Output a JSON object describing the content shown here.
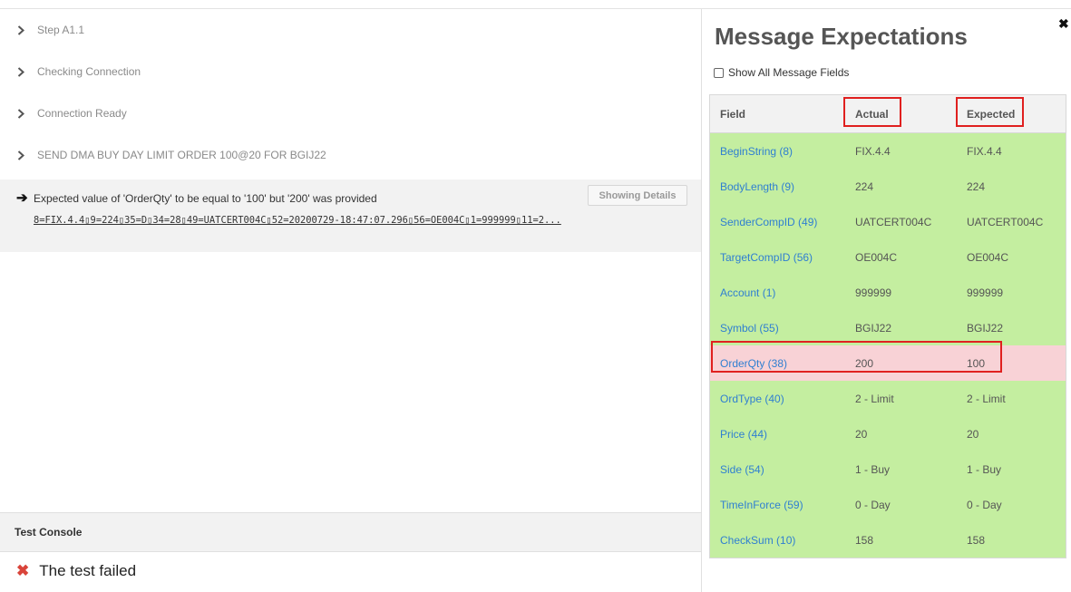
{
  "steps": [
    {
      "label": "Step A1.1"
    },
    {
      "label": "Checking Connection"
    },
    {
      "label": "Connection Ready"
    },
    {
      "label": "SEND DMA BUY DAY LIMIT ORDER 100@20 FOR BGIJ22"
    }
  ],
  "detail": {
    "message": "Expected value of 'OrderQty' to be equal to '100' but '200' was provided",
    "button_label": "Showing Details",
    "raw_message": "8=FIX.4.4▯9=224▯35=D▯34=28▯49=UATCERT004C▯52=20200729-18:47:07.296▯56=OE004C▯1=999999▯11=2..."
  },
  "console": {
    "header": "Test Console",
    "result": "The test failed",
    "status_color": "#d9443a"
  },
  "expectations": {
    "title": "Message Expectations",
    "show_all_label": "Show All Message Fields",
    "show_all_checked": false,
    "columns": {
      "field": "Field",
      "actual": "Actual",
      "expected": "Expected"
    },
    "rows": [
      {
        "field": "BeginString (8)",
        "actual": "FIX.4.4",
        "expected": "FIX.4.4",
        "match": true
      },
      {
        "field": "BodyLength (9)",
        "actual": "224",
        "expected": "224",
        "match": true
      },
      {
        "field": "SenderCompID (49)",
        "actual": "UATCERT004C",
        "expected": "UATCERT004C",
        "match": true
      },
      {
        "field": "TargetCompID (56)",
        "actual": "OE004C",
        "expected": "OE004C",
        "match": true
      },
      {
        "field": "Account (1)",
        "actual": "999999",
        "expected": "999999",
        "match": true
      },
      {
        "field": "Symbol (55)",
        "actual": "BGIJ22",
        "expected": "BGIJ22",
        "match": true
      },
      {
        "field": "OrderQty (38)",
        "actual": "200",
        "expected": "100",
        "match": false
      },
      {
        "field": "OrdType (40)",
        "actual": "2 - Limit",
        "expected": "2 - Limit",
        "match": true
      },
      {
        "field": "Price (44)",
        "actual": "20",
        "expected": "20",
        "match": true
      },
      {
        "field": "Side (54)",
        "actual": "1 - Buy",
        "expected": "1 - Buy",
        "match": true
      },
      {
        "field": "TimeInForce (59)",
        "actual": "0 - Day",
        "expected": "0 - Day",
        "match": true
      },
      {
        "field": "CheckSum (10)",
        "actual": "158",
        "expected": "158",
        "match": true
      }
    ],
    "colors": {
      "match": "#c4eea0",
      "mismatch": "#f8d2d6",
      "highlight": "#e0201f",
      "field_link": "#2f7fd1"
    }
  }
}
